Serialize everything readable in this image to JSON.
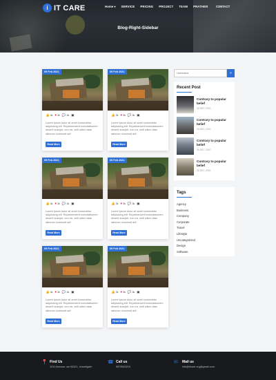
{
  "brand": {
    "name": "IT CARE",
    "mark": "i"
  },
  "nav": {
    "items": [
      {
        "label": "Home",
        "has_caret": true
      },
      {
        "label": "SERVICE"
      },
      {
        "label": "PRICING"
      },
      {
        "label": "PROJECT"
      },
      {
        "label": "TEAM"
      },
      {
        "label": "PRATHER"
      }
    ],
    "contact_label": "CONTACT"
  },
  "page_title": "Blog-Right-Sidebar",
  "posts": [
    {
      "date": "09 Feb 2021",
      "likes": "3k",
      "hearts": "3k",
      "comments": "3k",
      "excerpt": "Lorem ipsum dolor sit amet consectetur adipisicing elit. Reprehenderit exercitationem deserit suscipit, non ea, velit ullam vitae laborum commodi ad!",
      "button": "Read More"
    },
    {
      "date": "09 Feb 2021",
      "likes": "3k",
      "hearts": "3k",
      "comments": "3k",
      "excerpt": "Lorem ipsum dolor sit amet consectetur adipisicing elit. Reprehenderit exercitationem deserit suscipit, non ea, velit ullam vitae laborum commodi ad!",
      "button": "Read More"
    },
    {
      "date": "09 Feb 2021",
      "likes": "3k",
      "hearts": "3k",
      "comments": "3k",
      "excerpt": "Lorem ipsum dolor sit amet consectetur adipisicing elit. Reprehenderit exercitationem deserit suscipit, non ea, velit ullam vitae laborum commodi ad!",
      "button": "Read More"
    },
    {
      "date": "09 Feb 2021",
      "likes": "3k",
      "hearts": "3k",
      "comments": "3k",
      "excerpt": "Lorem ipsum dolor sit amet consectetur adipisicing elit. Reprehenderit exercitationem deserit suscipit, non ea, velit ullam vitae laborum commodi ad!",
      "button": "Read More"
    },
    {
      "date": "09 Feb 2021",
      "likes": "3k",
      "hearts": "3k",
      "comments": "3k",
      "excerpt": "Lorem ipsum dolor sit amet consectetur adipisicing elit. Reprehenderit exercitationem deserit suscipit, non ea, velit ullam vitae laborum commodi ad!",
      "button": "Read More"
    },
    {
      "date": "09 Feb 2021",
      "likes": "3k",
      "hearts": "3k",
      "comments": "3k",
      "excerpt": "Lorem ipsum dolor sit amet consectetur adipisicing elit. Reprehenderit exercitationem deserit suscipit, non ea, velit ullam vitae laborum commodi ad!",
      "button": "Read More"
    }
  ],
  "sidebar": {
    "search_placeholder": "Username",
    "recent_title": "Recent Post",
    "recent_posts": [
      {
        "title": "Contrary to popular belief",
        "date": "26 DEC 2020"
      },
      {
        "title": "Contrary to popular belief",
        "date": "26 DEC 2020"
      },
      {
        "title": "Contrary to popular belief",
        "date": "26 DEC 2020"
      },
      {
        "title": "Contrary to popular belief",
        "date": "26 DEC 2020"
      }
    ],
    "tags_title": "Tags",
    "tags": [
      "Agency",
      "Business",
      "Company",
      "Corporate",
      "Travel",
      "Lifestyle",
      "Uncategorized",
      "Design",
      "Software"
    ]
  },
  "footer": {
    "find": {
      "title": "Find Us",
      "text": "1010 Avenue, sw 54321, chandigarh"
    },
    "call": {
      "title": "Call us",
      "text": "9876543210"
    },
    "mail": {
      "title": "Mail us",
      "text": "info@itcare.org@gmail.com"
    }
  },
  "colors": {
    "accent": "#2f6fd6",
    "heart": "#d9343a",
    "footer": "#181a1d"
  }
}
